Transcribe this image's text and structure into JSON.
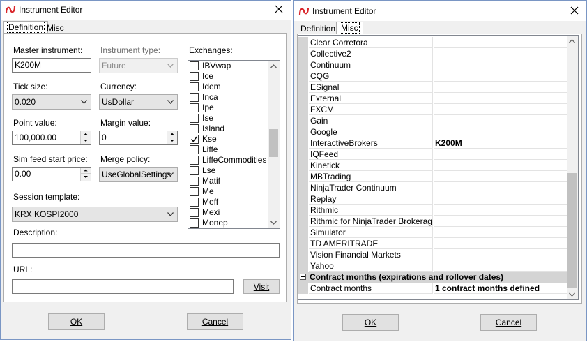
{
  "left_window": {
    "title": "Instrument Editor",
    "tabs": [
      "Definition",
      "Misc"
    ],
    "labels": {
      "master_instrument": "Master instrument:",
      "instrument_type": "Instrument type:",
      "exchanges": "Exchanges:",
      "tick_size": "Tick size:",
      "currency": "Currency:",
      "point_value": "Point value:",
      "margin_value": "Margin value:",
      "sim_feed": "Sim feed start price:",
      "merge_policy": "Merge policy:",
      "session_template": "Session template:",
      "description": "Description:",
      "url": "URL:"
    },
    "values": {
      "master_instrument": "K200M",
      "instrument_type": "Future",
      "tick_size": "0.020",
      "currency": "UsDollar",
      "point_value": "100,000.00",
      "margin_value": "0",
      "sim_feed": "0.00",
      "merge_policy": "UseGlobalSettings",
      "session_template": "KRX KOSPI2000",
      "description": "",
      "url": ""
    },
    "exchanges": [
      {
        "name": "IBVwap",
        "checked": false
      },
      {
        "name": "Ice",
        "checked": false
      },
      {
        "name": "Idem",
        "checked": false
      },
      {
        "name": "Inca",
        "checked": false
      },
      {
        "name": "Ipe",
        "checked": false
      },
      {
        "name": "Ise",
        "checked": false
      },
      {
        "name": "Island",
        "checked": false
      },
      {
        "name": "Kse",
        "checked": true
      },
      {
        "name": "Liffe",
        "checked": false
      },
      {
        "name": "LiffeCommodities",
        "checked": false
      },
      {
        "name": "Lse",
        "checked": false
      },
      {
        "name": "Matif",
        "checked": false
      },
      {
        "name": "Me",
        "checked": false
      },
      {
        "name": "Meff",
        "checked": false
      },
      {
        "name": "Mexi",
        "checked": false
      },
      {
        "name": "Monep",
        "checked": false
      }
    ],
    "buttons": {
      "visit": "Visit",
      "ok": "OK",
      "cancel": "Cancel"
    }
  },
  "right_window": {
    "title": "Instrument Editor",
    "tabs": [
      "Definition",
      "Misc"
    ],
    "rows": [
      {
        "key": "Clear Corretora",
        "value": ""
      },
      {
        "key": "Collective2",
        "value": ""
      },
      {
        "key": "Continuum",
        "value": ""
      },
      {
        "key": "CQG",
        "value": ""
      },
      {
        "key": "ESignal",
        "value": ""
      },
      {
        "key": "External",
        "value": ""
      },
      {
        "key": "FXCM",
        "value": ""
      },
      {
        "key": "Gain",
        "value": ""
      },
      {
        "key": "Google",
        "value": ""
      },
      {
        "key": "InteractiveBrokers",
        "value": "K200M"
      },
      {
        "key": "IQFeed",
        "value": ""
      },
      {
        "key": "Kinetick",
        "value": ""
      },
      {
        "key": "MBTrading",
        "value": ""
      },
      {
        "key": "NinjaTrader Continuum",
        "value": ""
      },
      {
        "key": "Replay",
        "value": ""
      },
      {
        "key": "Rithmic",
        "value": ""
      },
      {
        "key": "Rithmic for NinjaTrader Brokerage",
        "value": ""
      },
      {
        "key": "Simulator",
        "value": ""
      },
      {
        "key": "TD AMERITRADE",
        "value": ""
      },
      {
        "key": "Vision Financial Markets",
        "value": ""
      },
      {
        "key": "Yahoo",
        "value": ""
      }
    ],
    "category": "Contract months (expirations and rollover dates)",
    "contract_row": {
      "key": "Contract months",
      "value": "1 contract months defined"
    },
    "buttons": {
      "ok": "OK",
      "cancel": "Cancel"
    }
  },
  "colors": {
    "logo": "#d9262b",
    "window_border": "#7a96c4",
    "thumb": "#c1c1c1"
  }
}
